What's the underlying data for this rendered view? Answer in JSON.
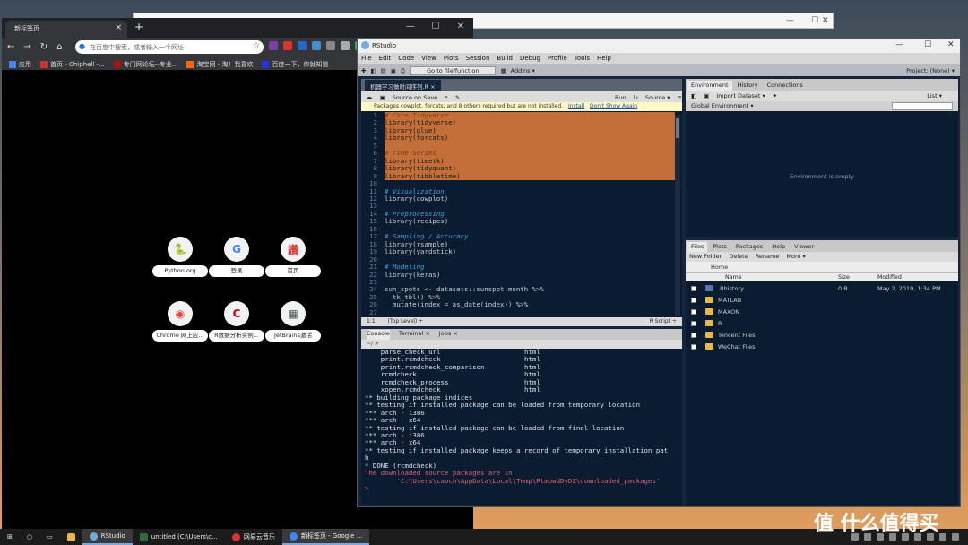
{
  "back_window": {
    "controls": [
      "—",
      "☐",
      "✕"
    ]
  },
  "chrome": {
    "tab_title": "新标签页",
    "tab_close": "×",
    "new_tab": "+",
    "window_controls": [
      "—",
      "☐",
      "✕"
    ],
    "nav": [
      "←",
      "→",
      "↻",
      "⌂"
    ],
    "omnibox_placeholder": "在百度中搜索，或者输入一个网址",
    "bookmarks": [
      "应用",
      "首页 - Chiphell -...",
      "专门网论坛--专业...",
      "淘宝网 - 淘！我喜欢",
      "百度一下，你就知道"
    ],
    "tiles": [
      {
        "label": "Python.org",
        "glyph": "🐍",
        "color": "#3572A5"
      },
      {
        "label": "登录",
        "glyph": "G",
        "color": "#4285f4"
      },
      {
        "label": "首页",
        "glyph": "讚",
        "color": "#d33"
      },
      {
        "label": "Chrome 网上应...",
        "glyph": "◉",
        "color": "#e94235"
      },
      {
        "label": "R数据分析实例...",
        "glyph": "C",
        "color": "#c00"
      },
      {
        "label": "JetBrains激活",
        "glyph": "▦",
        "color": "#555"
      }
    ]
  },
  "rstudio": {
    "title": "RStudio",
    "window_controls": [
      "—",
      "☐",
      "✕"
    ],
    "menu": [
      "File",
      "Edit",
      "Code",
      "View",
      "Plots",
      "Session",
      "Build",
      "Debug",
      "Profile",
      "Tools",
      "Help"
    ],
    "goto": "Go to file/function",
    "addins": "Addins ▾",
    "project": "Project: (None) ▾",
    "editor": {
      "tab": "机器学习做时间序列.R ×",
      "source_on_save": "Source on Save",
      "run": "Run",
      "source": "Source ▾",
      "warning": "Packages cowplot, forcats, and 8 others required but are not installed.",
      "install": "Install",
      "dont_show": "Don't Show Again",
      "lines": [
        {
          "n": "1",
          "t": "# Core Tidyverse",
          "sel": true,
          "cm": true
        },
        {
          "n": "2",
          "t": "library(tidyverse)",
          "sel": true
        },
        {
          "n": "3",
          "t": "library(glue)",
          "sel": true
        },
        {
          "n": "4",
          "t": "library(forcats)",
          "sel": true
        },
        {
          "n": "5",
          "t": "",
          "sel": true
        },
        {
          "n": "6",
          "t": "# Time Series",
          "sel": true,
          "cm": true
        },
        {
          "n": "7",
          "t": "library(timetk)",
          "sel": true
        },
        {
          "n": "8",
          "t": "library(tidyquant)",
          "sel": true
        },
        {
          "n": "9",
          "t": "library(tibbletime)",
          "sel": true
        },
        {
          "n": "10",
          "t": ""
        },
        {
          "n": "11",
          "t": "# Visualization",
          "cm": true
        },
        {
          "n": "12",
          "t": "library(cowplot)"
        },
        {
          "n": "13",
          "t": ""
        },
        {
          "n": "14",
          "t": "# Preprocessing",
          "cm": true
        },
        {
          "n": "15",
          "t": "library(recipes)"
        },
        {
          "n": "16",
          "t": ""
        },
        {
          "n": "17",
          "t": "# Sampling / Accuracy",
          "cm": true
        },
        {
          "n": "18",
          "t": "library(rsample)"
        },
        {
          "n": "19",
          "t": "library(yardstick)"
        },
        {
          "n": "20",
          "t": ""
        },
        {
          "n": "21",
          "t": "# Modeling",
          "cm": true
        },
        {
          "n": "22",
          "t": "library(keras)"
        },
        {
          "n": "23",
          "t": ""
        },
        {
          "n": "24",
          "t": "sun_spots <- datasets::sunspot.month %>%"
        },
        {
          "n": "25",
          "t": "  tk_tbl() %>%"
        },
        {
          "n": "26",
          "t": "  mutate(index = as_date(index)) %>%"
        },
        {
          "n": "27",
          "t": ""
        }
      ],
      "status_pos": "1:1",
      "status_scope": "(Top Level) ÷",
      "status_type": "R Script ÷"
    },
    "console": {
      "tabs": [
        "Console",
        "Terminal ×",
        "Jobs ×"
      ],
      "path": "~/ ⇗",
      "lines": [
        {
          "t": "    parse_check_url                     html"
        },
        {
          "t": "    print.rcmdcheck                     html"
        },
        {
          "t": "    print.rcmdcheck_comparison          html"
        },
        {
          "t": "    rcmdcheck                           html"
        },
        {
          "t": "    rcmdcheck_process                   html"
        },
        {
          "t": "    xopen.rcmdcheck                     html"
        },
        {
          "t": "** building package indices"
        },
        {
          "t": "** testing if installed package can be loaded from temporary location"
        },
        {
          "t": "*** arch - i386"
        },
        {
          "t": "*** arch - x64"
        },
        {
          "t": "** testing if installed package can be loaded from final location"
        },
        {
          "t": "*** arch - i386"
        },
        {
          "t": "*** arch - x64"
        },
        {
          "t": "** testing if installed package keeps a record of temporary installation pat"
        },
        {
          "t": "h"
        },
        {
          "t": "* DONE (rcmdcheck)"
        },
        {
          "t": ""
        },
        {
          "t": "The downloaded source packages are in",
          "red": true
        },
        {
          "t": "        'C:\\Users\\caoch\\AppData\\Local\\Temp\\RtmpwdDyDZ\\downloaded_packages'",
          "red": true
        },
        {
          "t": "> ",
          "red": true
        }
      ]
    },
    "env": {
      "tabs": [
        "Environment",
        "History",
        "Connections"
      ],
      "import": "Import Dataset ▾",
      "list": "List ▾",
      "global": "Global Environment ▾",
      "empty": "Environment is empty"
    },
    "files": {
      "tabs": [
        "Files",
        "Plots",
        "Packages",
        "Help",
        "Viewer"
      ],
      "new_folder": "New Folder",
      "delete": "Delete",
      "rename": "Rename",
      "more": "More ▾",
      "path": "Home",
      "headers": [
        "Name",
        "Size",
        "Modified"
      ],
      "rows": [
        {
          "name": ".Rhistory",
          "size": "0 B",
          "mod": "May 2, 2019, 1:34 PM",
          "r": true
        },
        {
          "name": "MATLAB",
          "size": "",
          "mod": ""
        },
        {
          "name": "MAXON",
          "size": "",
          "mod": ""
        },
        {
          "name": "R",
          "size": "",
          "mod": ""
        },
        {
          "name": "Tencent Files",
          "size": "",
          "mod": ""
        },
        {
          "name": "WeChat Files",
          "size": "",
          "mod": ""
        }
      ]
    }
  },
  "taskbar": {
    "items": [
      {
        "label": "RStudio",
        "color": "#75aadb",
        "act": true
      },
      {
        "label": "untitled (C:\\Users\\c...",
        "color": "#2d6b3d"
      },
      {
        "label": "网易云音乐",
        "color": "#d33"
      },
      {
        "label": "新标签页 - Google ...",
        "color": "#4285f4",
        "act": true
      }
    ],
    "clock": "值 什么值得买"
  },
  "watermark": "值 什么值得买"
}
